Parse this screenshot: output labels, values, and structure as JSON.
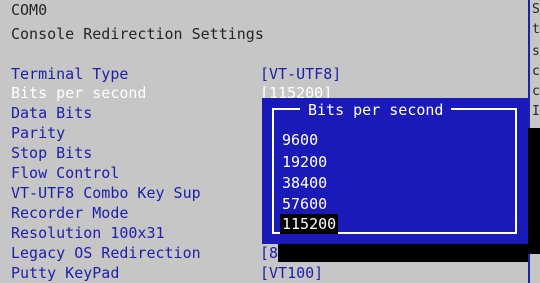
{
  "header": {
    "port": "COM0",
    "title": "Console Redirection Settings"
  },
  "settings": [
    {
      "label": "Terminal Type",
      "value": "[VT-UTF8]"
    },
    {
      "label": "Bits per second",
      "value": "[115200]"
    },
    {
      "label": "Data Bits",
      "value": ""
    },
    {
      "label": "Parity",
      "value": ""
    },
    {
      "label": "Stop Bits",
      "value": ""
    },
    {
      "label": "Flow Control",
      "value": ""
    },
    {
      "label": "VT-UTF8 Combo Key Sup",
      "value": ""
    },
    {
      "label": "Recorder Mode",
      "value": ""
    },
    {
      "label": "Resolution 100x31",
      "value": ""
    },
    {
      "label": "Legacy OS Redirection",
      "value": "[8"
    },
    {
      "label": "Putty KeyPad",
      "value": "[VT100]"
    }
  ],
  "popup": {
    "title": "Bits per second",
    "options": [
      "9600",
      "19200",
      "38400",
      "57600",
      "115200"
    ],
    "selected": "115200"
  },
  "help_chars": [
    "S",
    "t",
    "s",
    "c",
    "c",
    "I"
  ],
  "colors": {
    "background": "#c6c6c6",
    "label_blue": "#1e20a8",
    "popup_blue": "#1a1ab8",
    "highlight_white": "#ffffff"
  }
}
